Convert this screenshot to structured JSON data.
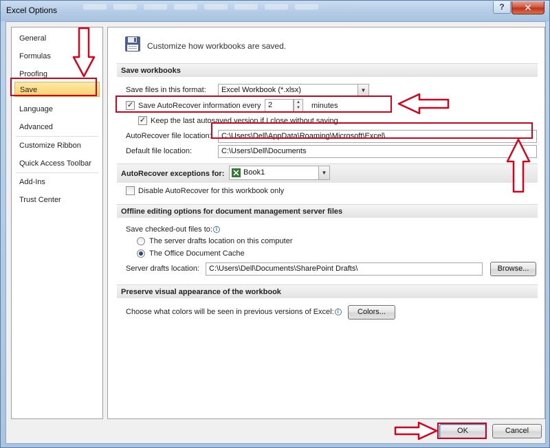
{
  "window": {
    "title": "Excel Options",
    "help_glyph": "?",
    "close_glyph": "✕"
  },
  "nav": {
    "items": [
      {
        "label": "General"
      },
      {
        "label": "Formulas"
      },
      {
        "label": "Proofing"
      },
      {
        "label": "Save",
        "selected": true
      },
      {
        "label": "Language"
      },
      {
        "label": "Advanced"
      },
      {
        "label": "Customize Ribbon"
      },
      {
        "label": "Quick Access Toolbar"
      },
      {
        "label": "Add-Ins"
      },
      {
        "label": "Trust Center"
      }
    ]
  },
  "main": {
    "heading": "Customize how workbooks are saved.",
    "save_workbooks": {
      "header": "Save workbooks",
      "format_label": "Save files in this format:",
      "format_value": "Excel Workbook (*.xlsx)",
      "autorecover_label": "Save AutoRecover information every",
      "autorecover_minutes": "2",
      "minutes_label": "minutes",
      "keep_last_label": "Keep the last autosaved version if I close without saving",
      "autorecover_location_label": "AutoRecover file location:",
      "autorecover_location_value": "C:\\Users\\Dell\\AppData\\Roaming\\Microsoft\\Excel\\",
      "default_location_label": "Default file location:",
      "default_location_value": "C:\\Users\\Dell\\Documents"
    },
    "exceptions": {
      "label": "AutoRecover exceptions for:",
      "workbook": "Book1",
      "disable_label": "Disable AutoRecover for this workbook only"
    },
    "offline": {
      "header": "Offline editing options for document management server files",
      "checked_out_label": "Save checked-out files to:",
      "option_server": "The server drafts location on this computer",
      "option_cache": "The Office Document Cache",
      "server_drafts_label": "Server drafts location:",
      "server_drafts_value": "C:\\Users\\Dell\\Documents\\SharePoint Drafts\\",
      "browse_label": "Browse..."
    },
    "preserve": {
      "header": "Preserve visual appearance of the workbook",
      "colors_question": "Choose what colors will be seen in previous versions of Excel:",
      "colors_button": "Colors..."
    }
  },
  "footer": {
    "ok_label": "OK",
    "cancel_label": "Cancel"
  },
  "colors": {
    "highlight": "#d8001a",
    "selected_nav": "#f8d06d"
  }
}
